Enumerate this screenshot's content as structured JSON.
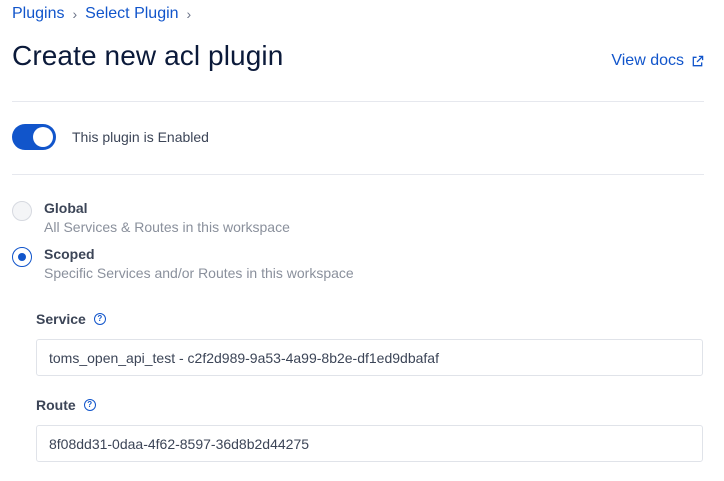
{
  "breadcrumb": {
    "items": [
      "Plugins",
      "Select Plugin"
    ],
    "separator": "›"
  },
  "page": {
    "title": "Create new acl plugin",
    "view_docs": "View docs"
  },
  "enable_toggle": {
    "label": "This plugin is Enabled",
    "enabled": true
  },
  "scope": {
    "options": [
      {
        "title": "Global",
        "description": "All Services & Routes in this workspace",
        "selected": false
      },
      {
        "title": "Scoped",
        "description": "Specific Services and/or Routes in this workspace",
        "selected": true
      }
    ]
  },
  "fields": {
    "service": {
      "label": "Service",
      "value": "toms_open_api_test - c2f2d989-9a53-4a99-8b2e-df1ed9dbafaf"
    },
    "route": {
      "label": "Route",
      "value": "8f08dd31-0daa-4f62-8597-36d8b2d44275"
    }
  },
  "colors": {
    "accent": "#1155cb",
    "divider": "#e6e8ee",
    "muted_text": "#8a909c"
  }
}
